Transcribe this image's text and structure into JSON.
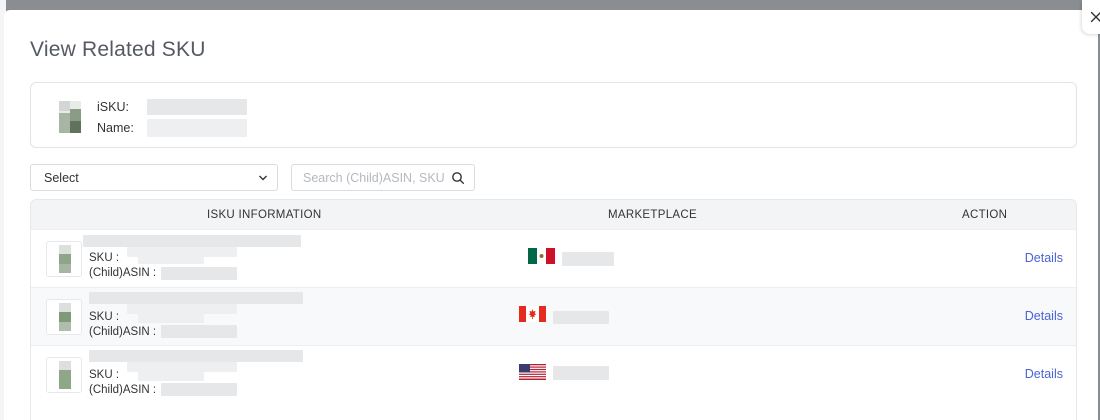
{
  "modal": {
    "title": "View Related SKU",
    "close_icon": "close-icon"
  },
  "isku_card": {
    "isku_label": "iSKU:",
    "name_label": "Name:"
  },
  "filters": {
    "select_value": "Select",
    "search_placeholder": "Search (Child)ASIN, SKU",
    "search_icon": "search-icon",
    "chevron_icon": "chevron-down-icon"
  },
  "table": {
    "headers": {
      "info": "ISKU INFORMATION",
      "marketplace": "MARKETPLACE",
      "action": "ACTION"
    },
    "rows": [
      {
        "sku_label": "SKU :",
        "asin_label": "(Child)ASIN :",
        "flag": "mexico-flag-icon",
        "action": "Details"
      },
      {
        "sku_label": "SKU :",
        "asin_label": "(Child)ASIN :",
        "flag": "canada-flag-icon",
        "action": "Details"
      },
      {
        "sku_label": "SKU :",
        "asin_label": "(Child)ASIN :",
        "flag": "usa-flag-icon",
        "action": "Details"
      }
    ]
  },
  "colors": {
    "link": "#4a63d6",
    "header_bg": "#f3f4f6",
    "border": "#e1e4e8"
  }
}
